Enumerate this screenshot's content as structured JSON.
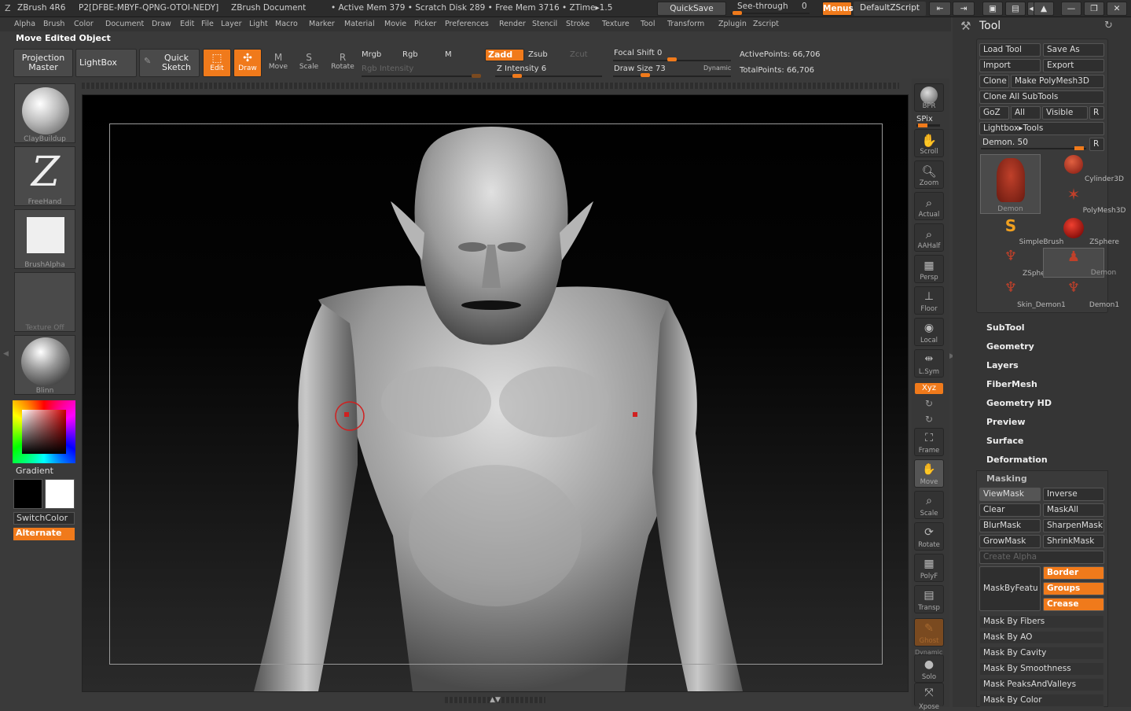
{
  "titlebar": {
    "app": "ZBrush 4R6",
    "serial": "P2[DFBE-MBYF-QPNG-OTOI-NEDY]",
    "doc": "ZBrush Document",
    "stats": "• Active Mem 379 • Scratch Disk 289 • Free Mem 3716 • ZTime▸1.5",
    "quicksave": "QuickSave",
    "seethrough": "See-through",
    "seethrough_value": "0",
    "menus": "Menus",
    "default_zscript": "DefaultZScript"
  },
  "menubar": [
    "Alpha",
    "Brush",
    "Color",
    "Document",
    "Draw",
    "Edit",
    "File",
    "Layer",
    "Light",
    "Macro",
    "Marker",
    "Material",
    "Movie",
    "Picker",
    "Preferences",
    "Render",
    "Stencil",
    "Stroke",
    "Texture",
    "Tool",
    "Transform",
    "Zplugin",
    "Zscript"
  ],
  "status": "Move Edited Object",
  "toolbar": {
    "projection_master": [
      "Projection",
      "Master"
    ],
    "lightbox": "LightBox",
    "quick_sketch": [
      "Quick",
      "Sketch"
    ],
    "edit": "Edit",
    "draw": "Draw",
    "move": "Move",
    "scale": "Scale",
    "rotate": "Rotate",
    "mrgb": "Mrgb",
    "rgb": "Rgb",
    "m": "M",
    "zadd": "Zadd",
    "zsub": "Zsub",
    "zcut": "Zcut",
    "rgb_intensity": "Rgb Intensity",
    "z_intensity": "Z Intensity 6",
    "focal_shift": "Focal Shift 0",
    "draw_size": "Draw Size 73",
    "dynamic": "Dynamic",
    "active_points": "ActivePoints: 66,706",
    "total_points": "TotalPoints: 66,706"
  },
  "left_shelf": {
    "brush": "ClayBuildup",
    "stroke": "FreeHand",
    "alpha": "BrushAlpha",
    "texture": "Texture Off",
    "material": "Blinn",
    "gradient": "Gradient",
    "switch_color": "SwitchColor",
    "alternate": "Alternate"
  },
  "right_shelf": [
    "BPR",
    "SPix",
    "Scroll",
    "Zoom",
    "Actual",
    "AAHalf",
    "Persp",
    "Floor",
    "Local",
    "L.Sym",
    "Xyz",
    "Frame",
    "Move",
    "Scale",
    "Rotate",
    "PolyF",
    "Transp",
    "Ghost",
    "Dynamic",
    "Solo",
    "Xpose"
  ],
  "tool_panel": {
    "title": "Tool",
    "load_tool": "Load Tool",
    "save_as": "Save As",
    "import": "Import",
    "export": "Export",
    "clone": "Clone",
    "make_polymesh": "Make PolyMesh3D",
    "clone_all": "Clone All SubTools",
    "goz": "GoZ",
    "all": "All",
    "visible": "Visible",
    "r": "R",
    "lightbox_tools": "Lightbox▸Tools",
    "demon_slider": "Demon. 50",
    "tools": [
      "Demon",
      "Cylinder3D",
      "PolyMesh3D",
      "SimpleBrush",
      "ZSphere",
      "ZSphere_1",
      "Demon",
      "Skin_Demon1",
      "Demon1"
    ],
    "sections": [
      "SubTool",
      "Geometry",
      "Layers",
      "FiberMesh",
      "Geometry HD",
      "Preview",
      "Surface",
      "Deformation"
    ],
    "masking": {
      "title": "Masking",
      "viewmask": "ViewMask",
      "inverse": "Inverse",
      "clear": "Clear",
      "maskall": "MaskAll",
      "blurmask": "BlurMask",
      "sharpenmask": "SharpenMask",
      "growmask": "GrowMask",
      "shrinkmask": "ShrinkMask",
      "create_alpha": "Create Alpha",
      "maskbyfeature": "MaskByFeatu",
      "border": "Border",
      "groups": "Groups",
      "crease": "Crease",
      "items": [
        "Mask By Fibers",
        "Mask By AO",
        "Mask By Cavity",
        "Mask By Smoothness",
        "Mask PeaksAndValleys",
        "Mask By Color"
      ]
    }
  },
  "colors": {
    "accent": "#f07a1b",
    "panel": "#353535",
    "canvas": "#000000"
  }
}
